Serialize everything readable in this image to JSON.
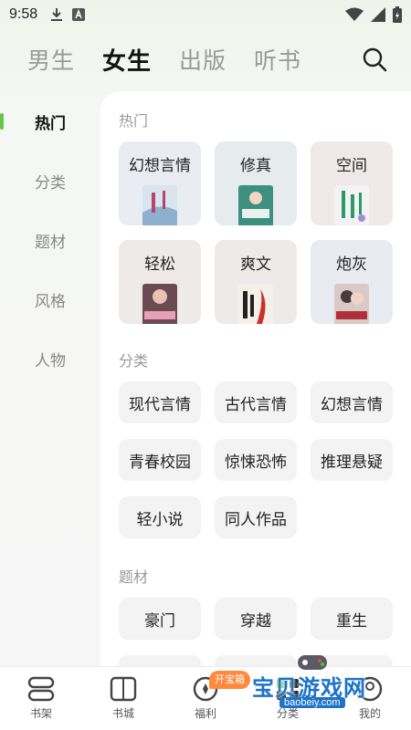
{
  "status": {
    "time": "9:58"
  },
  "topnav": {
    "tabs": [
      {
        "label": "男生"
      },
      {
        "label": "女生"
      },
      {
        "label": "出版"
      },
      {
        "label": "听书"
      }
    ],
    "active_tab": "女生"
  },
  "sidebar": {
    "items": [
      {
        "label": "热门"
      },
      {
        "label": "分类"
      },
      {
        "label": "题材"
      },
      {
        "label": "风格"
      },
      {
        "label": "人物"
      }
    ],
    "accent": "#6cc24a"
  },
  "hot": {
    "title": "热门",
    "cards": [
      {
        "label": "幻想言情",
        "bg": "#e9edf3"
      },
      {
        "label": "修真",
        "bg": "#e6ebee"
      },
      {
        "label": "空间",
        "bg": "#efe9e9"
      },
      {
        "label": "轻松",
        "bg": "#efeaea"
      },
      {
        "label": "爽文",
        "bg": "#efeaea"
      },
      {
        "label": "炮灰",
        "bg": "#e8ecf1"
      }
    ]
  },
  "category": {
    "title": "分类",
    "tags": [
      "现代言情",
      "古代言情",
      "幻想言情",
      "青春校园",
      "惊悚恐怖",
      "推理悬疑",
      "轻小说",
      "同人作品"
    ]
  },
  "theme": {
    "title": "题材",
    "tags": [
      "豪门",
      "穿越",
      "重生"
    ]
  },
  "bottombar": {
    "items": [
      {
        "label": "书架",
        "icon": "bookshelf-icon"
      },
      {
        "label": "书城",
        "icon": "bookstore-icon"
      },
      {
        "label": "福利",
        "icon": "welfare-icon"
      },
      {
        "label": "分类",
        "icon": "category-icon"
      },
      {
        "label": "我的",
        "icon": "profile-icon"
      }
    ],
    "badge": "开宝箱"
  },
  "watermark": {
    "text": "宝贝游戏网",
    "url": "baobeiy.com"
  }
}
